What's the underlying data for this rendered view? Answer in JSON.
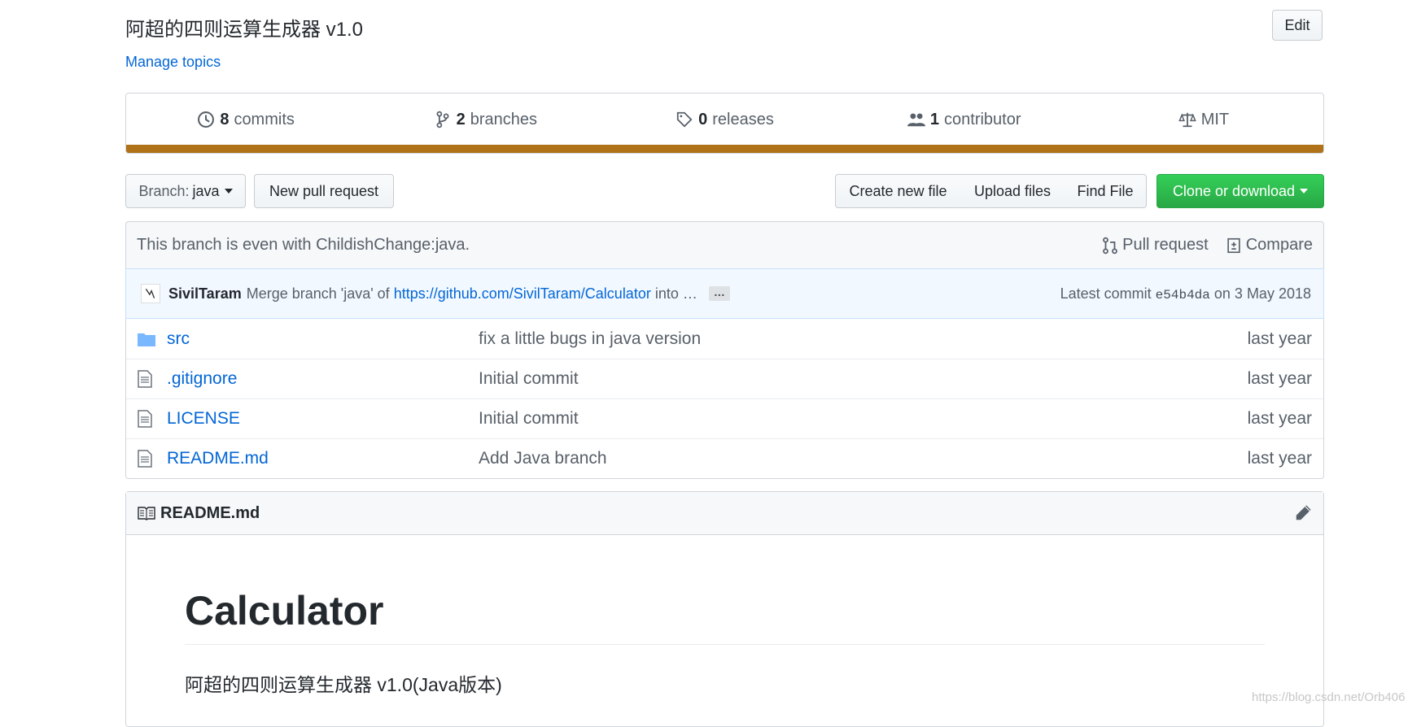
{
  "header": {
    "description": "阿超的四则运算生成器 v1.0",
    "manage_topics": "Manage topics",
    "edit_label": "Edit"
  },
  "summary": {
    "commits_count": "8",
    "commits_label": "commits",
    "branches_count": "2",
    "branches_label": "branches",
    "releases_count": "0",
    "releases_label": "releases",
    "contributors_count": "1",
    "contributors_label": "contributor",
    "license": "MIT",
    "language_color": "#b07219"
  },
  "toolbar": {
    "branch_prefix": "Branch:",
    "branch_name": "java",
    "new_pull_request": "New pull request",
    "create_new_file": "Create new file",
    "upload_files": "Upload files",
    "find_file": "Find File",
    "clone_or_download": "Clone or download"
  },
  "branch_info": {
    "text": "This branch is even with ChildishChange:java.",
    "pull_request": "Pull request",
    "compare": "Compare"
  },
  "commit": {
    "author": "SivilTaram",
    "message_prefix": "Merge branch 'java' of",
    "message_link": "https://github.com/SivilTaram/Calculator",
    "message_suffix": "into …",
    "more": "…",
    "latest_label": "Latest commit",
    "sha": "e54b4da",
    "date": "on 3 May 2018"
  },
  "files": [
    {
      "name": "src",
      "type": "folder",
      "message": "fix a little bugs in java version",
      "age": "last year"
    },
    {
      "name": ".gitignore",
      "type": "file",
      "message": "Initial commit",
      "age": "last year"
    },
    {
      "name": "LICENSE",
      "type": "file",
      "message": "Initial commit",
      "age": "last year"
    },
    {
      "name": "README.md",
      "type": "file",
      "message": "Add Java branch",
      "age": "last year"
    }
  ],
  "readme": {
    "filename": "README.md",
    "heading": "Calculator",
    "paragraph": "阿超的四则运算生成器 v1.0(Java版本)"
  },
  "watermark": "https://blog.csdn.net/Orb406",
  "colors": {
    "link": "#0366d6",
    "clone_green": "#28a745",
    "java_bar": "#b07219"
  }
}
